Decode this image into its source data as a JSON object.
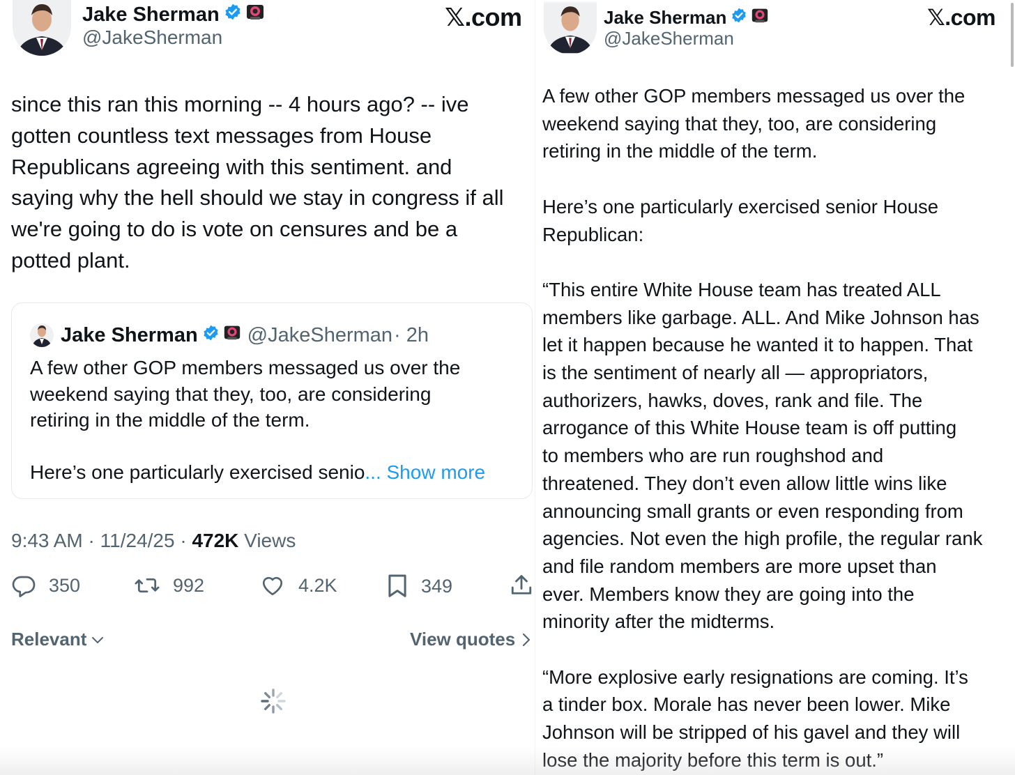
{
  "left_tweet": {
    "author": {
      "name": "Jake Sherman",
      "handle": "@JakeSherman"
    },
    "brand": "𝕏.com",
    "text": "since this ran this morning -- 4 hours ago? -- ive\ngotten countless text messages from House\nRepublicans agreeing with this sentiment. and\nsaying why the hell should we stay in congress if all\nwe're going to do is vote on censures and be a\npotted plant.",
    "quote": {
      "name": "Jake Sherman",
      "handle": "@JakeSherman",
      "time": "· 2h",
      "text": "A few other GOP members messaged us over the\nweekend saying that they, too, are considering\nretiring in the middle of the term.\n\nHere’s one particularly exercised senio",
      "show_more": "... Show more"
    },
    "meta": {
      "time": "9:43 AM",
      "date": "11/24/25",
      "views_count": "472K",
      "views_label": "Views",
      "sep": " · "
    },
    "actions": {
      "replies": "350",
      "reposts": "992",
      "likes": "4.2K",
      "bookmarks": "349"
    },
    "footer": {
      "sort_label": "Relevant",
      "quotes_label": "View quotes"
    }
  },
  "right_tweet": {
    "author": {
      "name": "Jake Sherman",
      "handle": "@JakeSherman"
    },
    "brand": "𝕏.com",
    "text": "A few other GOP members messaged us over the\nweekend saying that they, too, are considering\nretiring in the middle of the term.\n\nHere’s one particularly exercised senior House\nRepublican:\n\n“This entire White House team has treated ALL\nmembers like garbage. ALL. And Mike Johnson has\nlet it happen because he wanted it to happen. That\nis the sentiment of nearly all — appropriators,\nauthorizers, hawks, doves, rank and file. The\narrogance of this White House team is off putting\nto members who are run roughshod and\nthreatened. They don’t even allow little wins like\nannouncing small grants or even responding from\nagencies. Not even the high profile, the regular rank\nand file random members are more upset than\never. Members know they are going into the\nminority after the midterms.\n\n“More explosive early resignations are coming. It’s\na tinder box. Morale has never been lower. Mike\nJohnson will be stripped of his gavel and they will\nlose the majority before this term is out.”"
  },
  "colors": {
    "text": "#0f1419",
    "secondary": "#536471",
    "link": "#1d9bf0",
    "verified": "#1d9bf0",
    "border": "#e6e9ec"
  },
  "icons": [
    "avatar",
    "verified-badge-icon",
    "affiliate-badge-icon",
    "reply-icon",
    "repost-icon",
    "like-icon",
    "bookmark-icon",
    "share-icon",
    "chevron-down-icon",
    "chevron-right-icon",
    "loading-spinner-icon"
  ]
}
